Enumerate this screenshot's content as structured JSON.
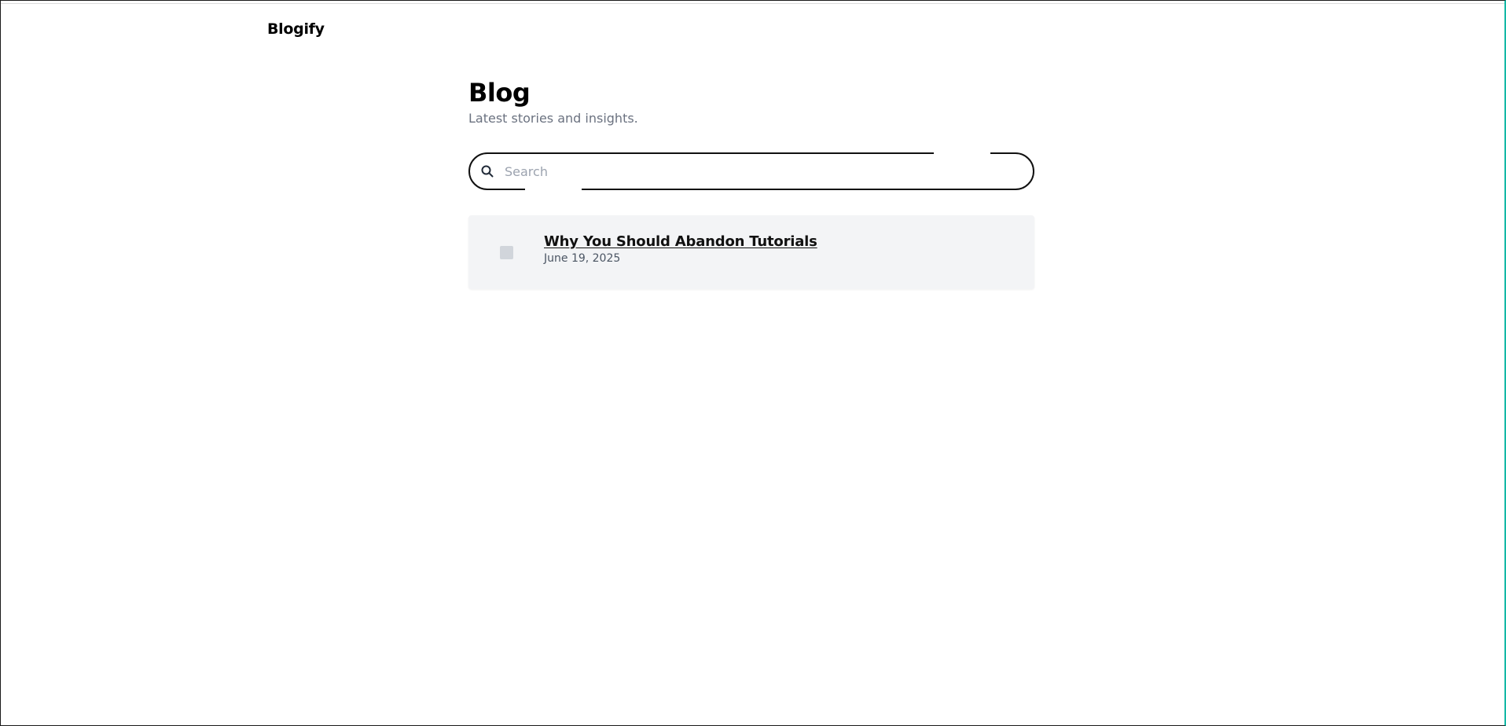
{
  "header": {
    "brand": "Blogify"
  },
  "main": {
    "title": "Blog",
    "subtitle": "Latest stories and insights."
  },
  "search": {
    "icon": "search-icon",
    "placeholder": "Search",
    "value": ""
  },
  "posts": [
    {
      "title": "Why You Should Abandon Tutorials",
      "date": "June 19, 2025"
    }
  ],
  "colors": {
    "frame_right_accent": "#14b8a6",
    "subtitle": "#6b7280",
    "card_background": "#f3f4f6",
    "thumb": "#d1d5db"
  }
}
